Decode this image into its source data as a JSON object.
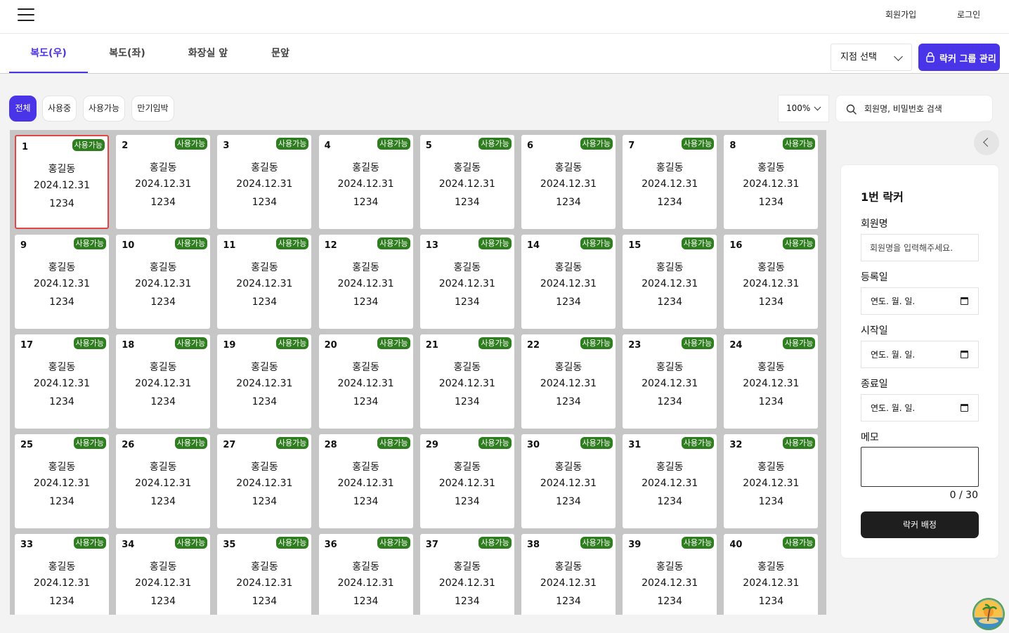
{
  "header": {
    "signup_label": "회원가입",
    "login_label": "로그인"
  },
  "tabs": [
    {
      "label": "복도(우)",
      "active": true
    },
    {
      "label": "복도(좌)",
      "active": false
    },
    {
      "label": "화장실 앞",
      "active": false
    },
    {
      "label": "문앞",
      "active": false
    }
  ],
  "branch_select": {
    "value": "지점 선택"
  },
  "group_button": {
    "label": "락커 그룹 관리"
  },
  "filters": [
    {
      "label": "전체",
      "active": true
    },
    {
      "label": "사용중",
      "active": false
    },
    {
      "label": "사용가능",
      "active": false
    },
    {
      "label": "만기임박",
      "active": false
    }
  ],
  "zoom": {
    "value": "100%"
  },
  "search": {
    "placeholder": "회원명, 비밀번호 검색"
  },
  "lockers": {
    "selected": "1",
    "items": [
      {
        "number": "1",
        "status": "사용가능",
        "name": "홍길동",
        "date": "2024.12.31",
        "password": "1234"
      },
      {
        "number": "2",
        "status": "사용가능",
        "name": "홍길동",
        "date": "2024.12.31",
        "password": "1234"
      },
      {
        "number": "3",
        "status": "사용가능",
        "name": "홍길동",
        "date": "2024.12.31",
        "password": "1234"
      },
      {
        "number": "4",
        "status": "사용가능",
        "name": "홍길동",
        "date": "2024.12.31",
        "password": "1234"
      },
      {
        "number": "5",
        "status": "사용가능",
        "name": "홍길동",
        "date": "2024.12.31",
        "password": "1234"
      },
      {
        "number": "6",
        "status": "사용가능",
        "name": "홍길동",
        "date": "2024.12.31",
        "password": "1234"
      },
      {
        "number": "7",
        "status": "사용가능",
        "name": "홍길동",
        "date": "2024.12.31",
        "password": "1234"
      },
      {
        "number": "8",
        "status": "사용가능",
        "name": "홍길동",
        "date": "2024.12.31",
        "password": "1234"
      },
      {
        "number": "9",
        "status": "사용가능",
        "name": "홍길동",
        "date": "2024.12.31",
        "password": "1234"
      },
      {
        "number": "10",
        "status": "사용가능",
        "name": "홍길동",
        "date": "2024.12.31",
        "password": "1234"
      },
      {
        "number": "11",
        "status": "사용가능",
        "name": "홍길동",
        "date": "2024.12.31",
        "password": "1234"
      },
      {
        "number": "12",
        "status": "사용가능",
        "name": "홍길동",
        "date": "2024.12.31",
        "password": "1234"
      },
      {
        "number": "13",
        "status": "사용가능",
        "name": "홍길동",
        "date": "2024.12.31",
        "password": "1234"
      },
      {
        "number": "14",
        "status": "사용가능",
        "name": "홍길동",
        "date": "2024.12.31",
        "password": "1234"
      },
      {
        "number": "15",
        "status": "사용가능",
        "name": "홍길동",
        "date": "2024.12.31",
        "password": "1234"
      },
      {
        "number": "16",
        "status": "사용가능",
        "name": "홍길동",
        "date": "2024.12.31",
        "password": "1234"
      },
      {
        "number": "17",
        "status": "사용가능",
        "name": "홍길동",
        "date": "2024.12.31",
        "password": "1234"
      },
      {
        "number": "18",
        "status": "사용가능",
        "name": "홍길동",
        "date": "2024.12.31",
        "password": "1234"
      },
      {
        "number": "19",
        "status": "사용가능",
        "name": "홍길동",
        "date": "2024.12.31",
        "password": "1234"
      },
      {
        "number": "20",
        "status": "사용가능",
        "name": "홍길동",
        "date": "2024.12.31",
        "password": "1234"
      },
      {
        "number": "21",
        "status": "사용가능",
        "name": "홍길동",
        "date": "2024.12.31",
        "password": "1234"
      },
      {
        "number": "22",
        "status": "사용가능",
        "name": "홍길동",
        "date": "2024.12.31",
        "password": "1234"
      },
      {
        "number": "23",
        "status": "사용가능",
        "name": "홍길동",
        "date": "2024.12.31",
        "password": "1234"
      },
      {
        "number": "24",
        "status": "사용가능",
        "name": "홍길동",
        "date": "2024.12.31",
        "password": "1234"
      },
      {
        "number": "25",
        "status": "사용가능",
        "name": "홍길동",
        "date": "2024.12.31",
        "password": "1234"
      },
      {
        "number": "26",
        "status": "사용가능",
        "name": "홍길동",
        "date": "2024.12.31",
        "password": "1234"
      },
      {
        "number": "27",
        "status": "사용가능",
        "name": "홍길동",
        "date": "2024.12.31",
        "password": "1234"
      },
      {
        "number": "28",
        "status": "사용가능",
        "name": "홍길동",
        "date": "2024.12.31",
        "password": "1234"
      },
      {
        "number": "29",
        "status": "사용가능",
        "name": "홍길동",
        "date": "2024.12.31",
        "password": "1234"
      },
      {
        "number": "30",
        "status": "사용가능",
        "name": "홍길동",
        "date": "2024.12.31",
        "password": "1234"
      },
      {
        "number": "31",
        "status": "사용가능",
        "name": "홍길동",
        "date": "2024.12.31",
        "password": "1234"
      },
      {
        "number": "32",
        "status": "사용가능",
        "name": "홍길동",
        "date": "2024.12.31",
        "password": "1234"
      },
      {
        "number": "33",
        "status": "사용가능",
        "name": "홍길동",
        "date": "2024.12.31",
        "password": "1234"
      },
      {
        "number": "34",
        "status": "사용가능",
        "name": "홍길동",
        "date": "2024.12.31",
        "password": "1234"
      },
      {
        "number": "35",
        "status": "사용가능",
        "name": "홍길동",
        "date": "2024.12.31",
        "password": "1234"
      },
      {
        "number": "36",
        "status": "사용가능",
        "name": "홍길동",
        "date": "2024.12.31",
        "password": "1234"
      },
      {
        "number": "37",
        "status": "사용가능",
        "name": "홍길동",
        "date": "2024.12.31",
        "password": "1234"
      },
      {
        "number": "38",
        "status": "사용가능",
        "name": "홍길동",
        "date": "2024.12.31",
        "password": "1234"
      },
      {
        "number": "39",
        "status": "사용가능",
        "name": "홍길동",
        "date": "2024.12.31",
        "password": "1234"
      },
      {
        "number": "40",
        "status": "사용가능",
        "name": "홍길동",
        "date": "2024.12.31",
        "password": "1234"
      }
    ]
  },
  "panel": {
    "title": "1번 락커",
    "member_label": "회원명",
    "member_placeholder": "회원명을 입력해주세요.",
    "register_label": "등록일",
    "start_label": "시작일",
    "end_label": "종료일",
    "date_placeholder": "연도. 월. 일.",
    "memo_label": "메모",
    "memo_counter": "0 / 30",
    "assign_label": "락커 배정"
  },
  "colors": {
    "accent": "#4a34e8",
    "badge_available": "#2e7d1e",
    "selected_border": "#e04646",
    "assign_button": "#1e1e1e"
  }
}
